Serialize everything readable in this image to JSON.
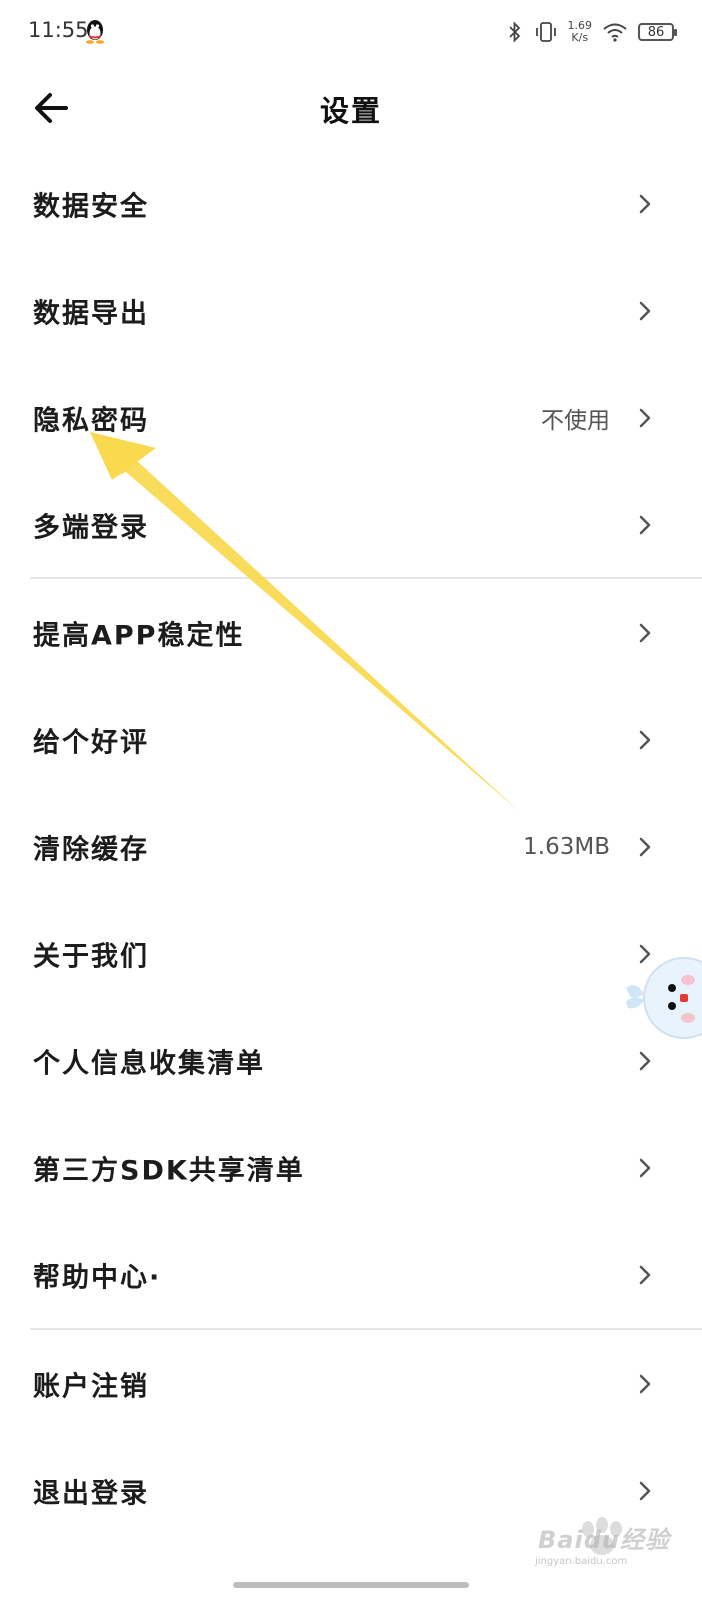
{
  "status_bar": {
    "time": "11:55",
    "speed_value": "1.69",
    "speed_unit": "K/s",
    "battery": "86",
    "icons": [
      "qq-icon",
      "bluetooth-icon",
      "vibrate-icon",
      "wifi-icon",
      "battery-icon"
    ]
  },
  "header": {
    "title": "设置",
    "back_icon": "back-arrow-icon"
  },
  "settings": {
    "items": [
      {
        "label": "数据安全",
        "value": ""
      },
      {
        "label": "数据导出",
        "value": ""
      },
      {
        "label": "隐私密码",
        "value": "不使用"
      },
      {
        "label": "多端登录",
        "value": ""
      },
      {
        "label": "提高APP稳定性",
        "value": ""
      },
      {
        "label": "给个好评",
        "value": ""
      },
      {
        "label": "清除缓存",
        "value": "1.63MB"
      },
      {
        "label": "关于我们",
        "value": ""
      },
      {
        "label": "个人信息收集清单",
        "value": ""
      },
      {
        "label": "第三方SDK共享清单",
        "value": ""
      },
      {
        "label": "帮助中心·",
        "value": ""
      },
      {
        "label": "账户注销",
        "value": ""
      },
      {
        "label": "退出登录",
        "value": ""
      }
    ]
  },
  "annotation": {
    "color": "#F9D94E"
  },
  "watermark": {
    "text": "Baidu经验",
    "sub": "jingyan.baidu.com"
  }
}
